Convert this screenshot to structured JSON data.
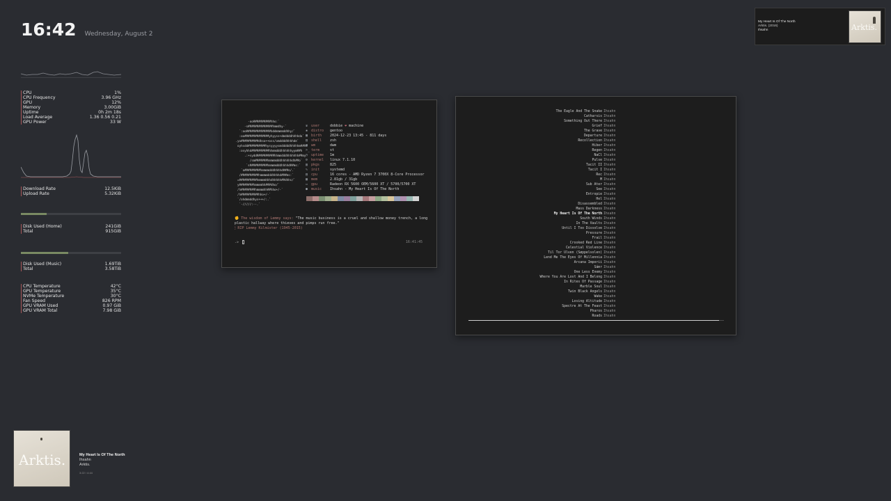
{
  "clock": {
    "time": "16:42",
    "date": "Wednesday, August 2"
  },
  "system": [
    {
      "label": "CPU",
      "value": "1%"
    },
    {
      "label": "CPU Frequency",
      "value": "3.96 GHz"
    },
    {
      "label": "GPU",
      "value": "12%"
    },
    {
      "label": "Memory",
      "value": "3.00GiB"
    },
    {
      "label": "Uptime",
      "value": "0h 2m 18s"
    },
    {
      "label": "Load Average",
      "value": "1.36 0.56 0.21"
    },
    {
      "label": "GPU Power",
      "value": "33 W"
    }
  ],
  "network": [
    {
      "label": "Download Rate",
      "value": "12.5KiB"
    },
    {
      "label": "Upload Rate",
      "value": "5.32KiB"
    }
  ],
  "disk_home": {
    "fraction": 0.26,
    "rows": [
      {
        "label": "Disk Used (Home)",
        "value": "241GiB"
      },
      {
        "label": "Total",
        "value": "915GiB"
      }
    ]
  },
  "disk_music": {
    "fraction": 0.47,
    "rows": [
      {
        "label": "Disk Used (Music)",
        "value": "1.69TiB"
      },
      {
        "label": "Total",
        "value": "3.58TiB"
      }
    ]
  },
  "sensors": [
    {
      "label": "CPU Temperature",
      "value": "42°C"
    },
    {
      "label": "GPU Temperature",
      "value": "35°C"
    },
    {
      "label": "NVMe Temperature",
      "value": "30°C"
    },
    {
      "label": "Fan Speed",
      "value": "826 RPM"
    },
    {
      "label": "GPU VRAM Used",
      "value": "0.97 GiB"
    },
    {
      "label": "GPU VRAM Total",
      "value": "7.98 GiB"
    }
  ],
  "fetch": {
    "ascii": "        -oo##########hho:`\n      -s##############hmmdhy-`\n   `:oo##############bddmmmmddhhy/`\n   :oo##############yhyyss+dmddddhhhhdo`\n .yo##########dhso++oss/omddddhhhhde`\n  oyhsdd##########hysyyyysmdddddhhhhhm##h:\n   :osyhhd##########hhmmdddhhhhhhyym##h\n      .:+sydd##########hhmmdddhhhhhhh##my\n         /sm#######hmmmmdddhhhhhhdh##o`\n       `s##########hmmmmdddhhhhd##ms:`\n    `o#########hmmmmdddhhhhd###o/.`\n   /##########hmmmmdddhhhhd###ms:`\n  =##########hmmmmhhhdhhhhh##dhhs/`\n  y########hmmmmhh###dho/`\n  /h########hmmmmhh##hho+/-`\n  /h##########hho+/-`\n  `/ohdmmddhys+++/:.`\n   `-/////:--.`",
    "info": [
      {
        "icon": "♛",
        "key": "user",
        "value": "dobbie",
        "heart": "❤",
        "value2": "machine"
      },
      {
        "icon": "❀",
        "key": "distro",
        "value": "gentoo"
      },
      {
        "icon": "▦",
        "key": "birth",
        "value": "2024-12-23 13:45 - 811 days"
      },
      {
        "icon": "▤",
        "key": "shell",
        "value": "zsh"
      },
      {
        "icon": "▣",
        "key": "wm",
        "value": "dwm"
      },
      {
        "icon": ">_",
        "key": "term",
        "value": "st"
      },
      {
        "icon": "◷",
        "key": "uptime",
        "value": "1m"
      },
      {
        "icon": "⚙",
        "key": "kernel",
        "value": "linux 7.1.10"
      },
      {
        "icon": "▥",
        "key": "pkgs",
        "value": "825"
      },
      {
        "icon": "✎",
        "key": "init",
        "value": "systemd"
      },
      {
        "icon": "▤",
        "key": "cpu",
        "value": "16 cores - AMD Ryzen 7 3700X 8-Core Processor"
      },
      {
        "icon": "▦",
        "key": "mem",
        "value": "2.81gb / 31gb"
      },
      {
        "icon": "▭",
        "key": "gpu",
        "value": "Radeon RX 5600 OEM/5600 XT / 5700/5700 XT"
      },
      {
        "icon": "●",
        "key": "music",
        "value": "Ihsahn - My Heart Is Of The North"
      }
    ],
    "swatches": [
      "#8d6f6b",
      "#b78d8c",
      "#7a8f72",
      "#9fae8e",
      "#c8b48a",
      "#7d8aa3",
      "#9a7e9e",
      "#7fa09c",
      "#b5b5b5",
      "#a5787b",
      "#c49ea0",
      "#8ea886",
      "#b3c19f",
      "#d8c69c",
      "#95a1ba",
      "#b092b1",
      "#98b8b3",
      "#d4d4d4"
    ],
    "quote_prefix": "✊ The wisdom of Lemmy says:",
    "quote_text": " \"The music business is a cruel and shallow money trench, a long plastic hallway where thieves and pimps run free.\"",
    "rip": "🕯 RIP Lemmy Kilmister (1945-2015)",
    "prompt": "-> ",
    "timestamp": "16:41:45"
  },
  "playlist": {
    "progress": 0.98,
    "tracks": [
      {
        "title": "The Eagle And The Snake",
        "artist": "Ihsahn"
      },
      {
        "title": "Catharsis",
        "artist": "Ihsahn"
      },
      {
        "title": "Something Out There",
        "artist": "Ihsahn"
      },
      {
        "title": "Grief",
        "artist": "Ihsahn"
      },
      {
        "title": "The Grave",
        "artist": "Ihsahn"
      },
      {
        "title": "Departure",
        "artist": "Ihsahn"
      },
      {
        "title": "Recollection",
        "artist": "Ihsahn"
      },
      {
        "title": "Hiber",
        "artist": "Ihsahn"
      },
      {
        "title": "Regen",
        "artist": "Ihsahn"
      },
      {
        "title": "NaCl",
        "artist": "Ihsahn"
      },
      {
        "title": "Pulse",
        "artist": "Ihsahn"
      },
      {
        "title": "Tacit II",
        "artist": "Ihsahn"
      },
      {
        "title": "Tacit I",
        "artist": "Ihsahn"
      },
      {
        "title": "Rec",
        "artist": "Ihsahn"
      },
      {
        "title": "M",
        "artist": "Ihsahn"
      },
      {
        "title": "Sub Ater",
        "artist": "Ihsahn"
      },
      {
        "title": "See",
        "artist": "Ihsahn"
      },
      {
        "title": "Entropie",
        "artist": "Ihsahn"
      },
      {
        "title": "Hel",
        "artist": "Ihsahn"
      },
      {
        "title": "Disassembled",
        "artist": "Ihsahn"
      },
      {
        "title": "Mass Darkness",
        "artist": "Ihsahn"
      },
      {
        "title": "My Heart Is Of The North",
        "artist": "Ihsahn",
        "current": true
      },
      {
        "title": "South Winds",
        "artist": "Ihsahn"
      },
      {
        "title": "In The Vaults",
        "artist": "Ihsahn"
      },
      {
        "title": "Until I Too Dissolve",
        "artist": "Ihsahn"
      },
      {
        "title": "Pressure",
        "artist": "Ihsahn"
      },
      {
        "title": "Frail",
        "artist": "Ihsahn"
      },
      {
        "title": "Crooked Red Line",
        "artist": "Ihsahn"
      },
      {
        "title": "Celestial Violence",
        "artist": "Ihsahn"
      },
      {
        "title": "Til Tor Ulven (Søppelsolen)",
        "artist": "Ihsahn"
      },
      {
        "title": "Lend Me The Eyes Of Millennia",
        "artist": "Ihsahn"
      },
      {
        "title": "Arcana Imperii",
        "artist": "Ihsahn"
      },
      {
        "title": "Sámr",
        "artist": "Ihsahn"
      },
      {
        "title": "One Less Enemy",
        "artist": "Ihsahn"
      },
      {
        "title": "Where You Are Lost And I Belong",
        "artist": "Ihsahn"
      },
      {
        "title": "In Rites Of Passage",
        "artist": "Ihsahn"
      },
      {
        "title": "Marble Soul",
        "artist": "Ihsahn"
      },
      {
        "title": "Twin Black Angels",
        "artist": "Ihsahn"
      },
      {
        "title": "Wake",
        "artist": "Ihsahn"
      },
      {
        "title": "Losing Altitude",
        "artist": "Ihsahn"
      },
      {
        "title": "Spectre At The Feast",
        "artist": "Ihsahn"
      },
      {
        "title": "Pharos",
        "artist": "Ihsahn"
      },
      {
        "title": "Roads",
        "artist": "Ihsahn"
      }
    ]
  },
  "mini_player": {
    "title": "My Heart Is Of The North",
    "album_line": "Arktis. (2016)",
    "artist": "Ihsahn",
    "cover_text": "Arktis."
  },
  "player": {
    "title": "My Heart Is Of The North",
    "artist": "Ihsahn",
    "album": "Arktis.",
    "position": "3:22 / 4:44",
    "cover_text": "Arktis."
  }
}
